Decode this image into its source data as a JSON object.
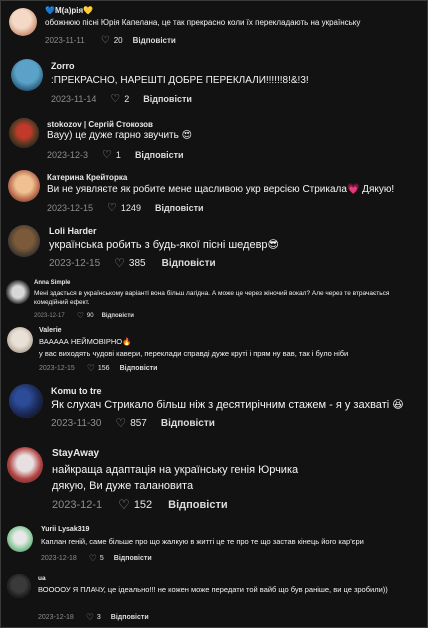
{
  "comments": [
    {
      "user": "М(а)рія",
      "user_prefix": "💙",
      "user_suffix": "💛",
      "text": "обожнюю пісні Юрія Капелана, це так прекрасно коли їх перекладають на українську",
      "date": "2023-11-11",
      "likes": "20",
      "reply": "Відповісти",
      "avatar_colors": [
        "#f3d9c6",
        "#c78b6a"
      ]
    },
    {
      "user": "Zorro",
      "text": ":ПРЕКРАСНО, НАРЕШТІ ДОБРЕ ПЕРЕКЛАЛИ!!!!!!8!&!3!",
      "date": "2023-11-14",
      "likes": "2",
      "reply": "Відповісти",
      "avatar_colors": [
        "#5aa2c8",
        "#1f4f6e"
      ]
    },
    {
      "user": "stokozov | Сергій Стокозов",
      "text": "Вауу) це дуже гарно звучить 😍",
      "date": "2023-12-3",
      "likes": "1",
      "reply": "Відповісти",
      "avatar_colors": [
        "#c0392b",
        "#3a2a1a"
      ]
    },
    {
      "user": "Катерина Крейторка",
      "text": "Ви не уявляєте як робите мене щасливою укр версією Стрикала💗 Дякую!",
      "date": "2023-12-15",
      "likes": "1249",
      "reply": "Відповісти",
      "avatar_colors": [
        "#f0c090",
        "#b4654a"
      ]
    },
    {
      "user": "Loli Harder",
      "text": "українська робить з будь-якої пісні шедевр😎",
      "date": "2023-12-15",
      "likes": "385",
      "reply": "Відповісти",
      "avatar_colors": [
        "#7a5a3a",
        "#2a2a2a"
      ]
    },
    {
      "user": "Anna Simple",
      "text": "Мені здається в українському варіанті вона більш лагідна. А може це через жіночий вокал? Але через те втрачається комедійний ефект.",
      "date": "2023-12-17",
      "likes": "90",
      "reply": "Відповісти",
      "avatar_colors": [
        "#d8d8d8",
        "#303030"
      ]
    },
    {
      "user": "Valerie",
      "text_line1": "ВААААА НЕЙМОВІРНО🔥",
      "text_line2": "у вас виходять чудові кавери, переклади справді дуже круті і прям ну вав, так і було ніби",
      "date": "2023-12-15",
      "likes": "156",
      "reply": "Відповісти",
      "avatar_colors": [
        "#e9e0d6",
        "#a89a8a"
      ]
    },
    {
      "user": "Komu to tre",
      "text": "Як слухач Стрикало більш ніж з десятирічним стажем - я у захваті 😆",
      "date": "2023-11-30",
      "likes": "857",
      "reply": "Відповісти",
      "avatar_colors": [
        "#1c2b5a",
        "#0a0f1e"
      ]
    },
    {
      "user": "StayAway",
      "text_line1": "найкраща адаптація на українську генія Юрчика",
      "text_line2": "дякую, Ви дуже талановита",
      "date": "2023-12-1",
      "likes": "152",
      "reply": "Відповісти",
      "avatar_colors": [
        "#e8e0e0",
        "#b04040"
      ]
    },
    {
      "user": "Yurii Lysak319",
      "text": "Каплан геній, саме більше про що жалкую в житті це те про те що застав кінець його кар'єри",
      "date": "2023-12-18",
      "likes": "5",
      "reply": "Відповісти",
      "avatar_colors": [
        "#9ad0a8",
        "#e8e8e8"
      ]
    },
    {
      "user": "ua",
      "text": "ВООООУ Я ПЛАЧУ, це ідеально!!! не кожен може передати той вайб що був раніше, ви це зробили))",
      "date": "2023-12-18",
      "likes": "3",
      "reply": "Відповісти",
      "avatar_colors": [
        "#3a3a3a",
        "#111111"
      ]
    }
  ],
  "icons": {
    "like": "heart-outline-icon"
  }
}
